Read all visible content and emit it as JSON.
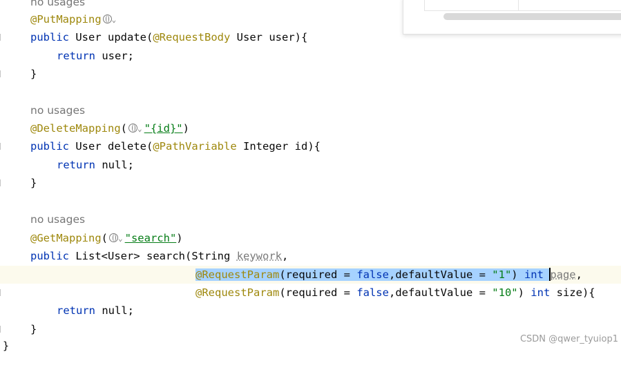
{
  "editor": {
    "hint_top": "no usages",
    "put": {
      "annotation": "@PutMapping",
      "sig_kw": "public",
      "sig_type": "User",
      "sig_method": "update(",
      "sig_anno": "@RequestBody",
      "sig_rest": "User user){",
      "ret_kw": "return",
      "ret_val": "user;",
      "close": "}"
    },
    "delete": {
      "hint": "no usages",
      "annotation": "@DeleteMapping",
      "paren_open": "(",
      "path": "\"{id}\"",
      "paren_close": ")",
      "sig_kw": "public",
      "sig_type": "User",
      "sig_method": "delete(",
      "sig_anno": "@PathVariable",
      "sig_rest": "Integer id){",
      "ret_kw": "return",
      "ret_val": "null;",
      "close": "}"
    },
    "get": {
      "hint": "no usages",
      "annotation": "@GetMapping",
      "paren_open": "(",
      "path": "\"search\"",
      "paren_close": ")",
      "sig_kw": "public",
      "sig_type": "List<User>",
      "sig_method": "search(String",
      "sig_param": "keywork",
      "sig_comma": ",",
      "p1_anno": "@RequestParam",
      "p1_open": "(required = ",
      "p1_false": "false",
      "p1_mid": ",defaultValue = ",
      "p1_str": "\"1\"",
      "p1_close": ") ",
      "p1_kw": "int",
      "p1_name": "page",
      "p1_end": ",",
      "p2_anno": "@RequestParam",
      "p2_open": "(required = ",
      "p2_false": "false",
      "p2_mid": ",defaultValue = ",
      "p2_str": "\"10\"",
      "p2_close": ") ",
      "p2_kw": "int",
      "p2_name": "size",
      "p2_end": "){",
      "ret_kw": "return",
      "ret_val": "null;",
      "close": "}"
    },
    "class_close": "}"
  },
  "popup_fragment": "",
  "watermark": "CSDN @qwer_tyuiop1",
  "colors": {
    "annotation": "#9e880d",
    "keyword": "#0033b3",
    "string": "#067d17",
    "hint": "#767676",
    "selection": "#a6d2ff"
  },
  "icons": [
    "globe-icon",
    "chevron-down-icon"
  ]
}
